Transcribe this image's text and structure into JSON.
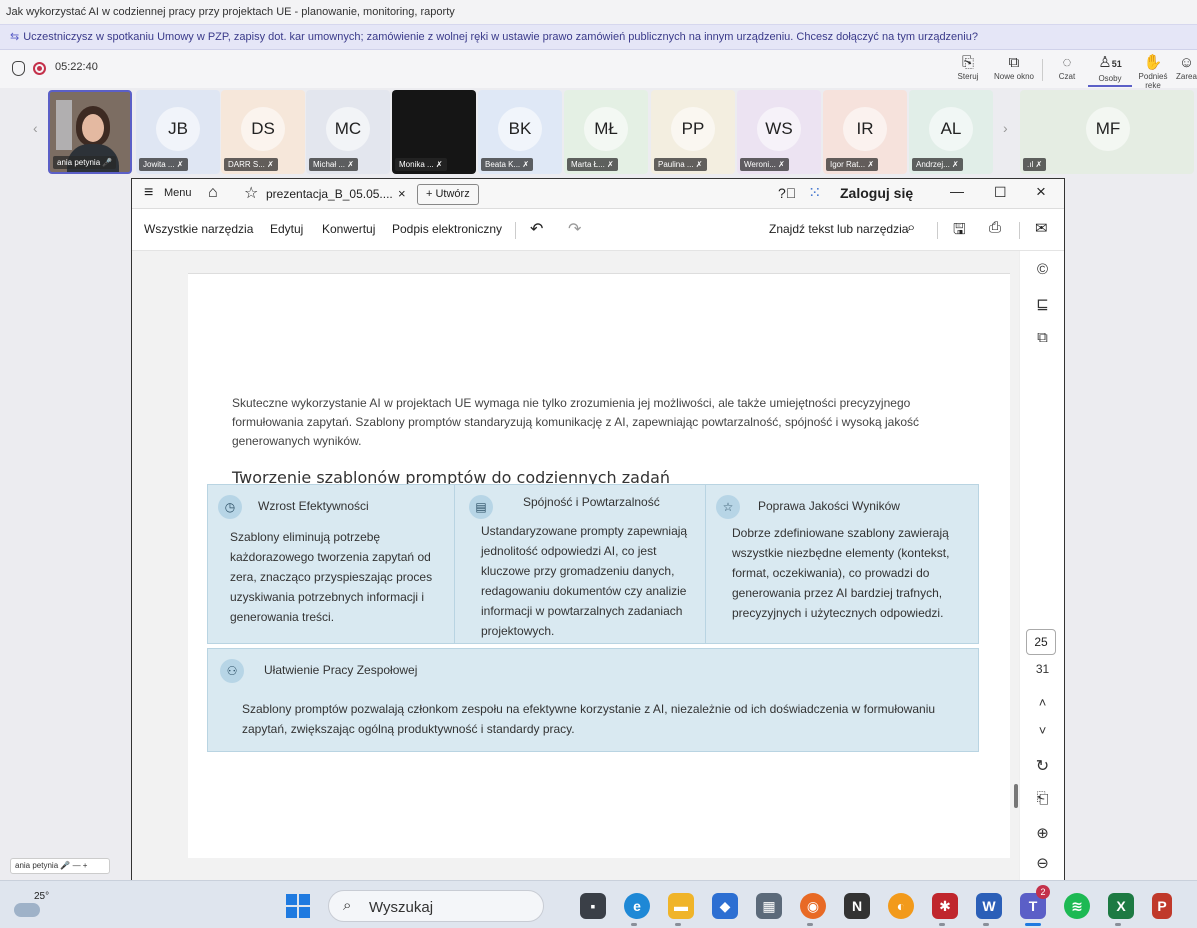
{
  "window_title": "Jak wykorzystać AI w codziennej pracy przy projektach UE - planowanie, monitoring, raporty",
  "notice": "Uczestniczysz w spotkaniu Umowy w PZP, zapisy dot. kar umownych; zamówienie z wolnej ręki w ustawie prawo zamówień publicznych na innym urządzeniu. Chcesz dołączyć na tym urządzeniu?",
  "meeting": {
    "timer": "05:22:40",
    "tools": [
      {
        "label": "Steruj",
        "icon": "control-icon"
      },
      {
        "label": "Nowe okno",
        "icon": "new-window-icon"
      },
      {
        "label": "Czat",
        "icon": "chat-icon"
      },
      {
        "label": "Osoby",
        "icon": "people-icon",
        "count": "51"
      },
      {
        "label": "Podnieś rękę",
        "icon": "raise-hand-icon"
      },
      {
        "label": "Zareaguj",
        "icon": "react-icon"
      }
    ]
  },
  "self_tile": {
    "name": "ania petynia"
  },
  "participants": [
    {
      "initials": "JB",
      "name": "Jowita ...",
      "color": "#dfe6f3"
    },
    {
      "initials": "DS",
      "name": "DARR S...",
      "color": "#f6e7da"
    },
    {
      "initials": "MC",
      "name": "Michał ...",
      "color": "#e3e6ee"
    },
    {
      "initials": "",
      "name": "Monika ...",
      "color": "#151515"
    },
    {
      "initials": "BK",
      "name": "Beata K...",
      "color": "#dfe8f6"
    },
    {
      "initials": "MŁ",
      "name": "Marta Ł...",
      "color": "#e4f0e4"
    },
    {
      "initials": "PP",
      "name": "Paulina ...",
      "color": "#f3eee0"
    },
    {
      "initials": "WS",
      "name": "Weroni...",
      "color": "#ece3f2"
    },
    {
      "initials": "IR",
      "name": "Igor Rat...",
      "color": "#f6e2dc"
    },
    {
      "initials": "AL",
      "name": "Andrzej...",
      "color": "#e1eee8"
    },
    {
      "initials": "MF",
      "name": ".ıl",
      "color": "#e5ede3"
    }
  ],
  "viewer": {
    "menu_label": "Menu",
    "tab_title": "prezentacja_B_05.05....",
    "new_tab_label": "Utwórz",
    "login_label": "Zaloguj się",
    "toolbar": [
      "Wszystkie narzędzia",
      "Edytuj",
      "Konwertuj",
      "Podpis elektroniczny"
    ],
    "search_label": "Znajdź tekst lub narzędzia",
    "page_current": "25",
    "page_total": "31"
  },
  "slide": {
    "title": "Tworzenie szablonów promptów do codziennych zadań",
    "intro": "Skuteczne wykorzystanie AI w projektach UE wymaga nie tylko zrozumienia jej możliwości, ale także umiejętności precyzyjnego formułowania zapytań. Szablony promptów standaryzują komunikację z AI, zapewniając powtarzalność, spójność i wysoką jakość generowanych wyników.",
    "cards": [
      {
        "title": "Wzrost Efektywności",
        "icon": "stopwatch-icon",
        "text": "Szablony eliminują potrzebę każdorazowego tworzenia zapytań od zera, znacząco przyspieszając proces uzyskiwania potrzebnych informacji i generowania treści."
      },
      {
        "title": "Spójność i Powtarzalność",
        "icon": "document-icon",
        "text": "Ustandaryzowane prompty zapewniają jednolitość odpowiedzi AI, co jest kluczowe przy gromadzeniu danych, redagowaniu dokumentów czy analizie informacji w powtarzalnych zadaniach projektowych."
      },
      {
        "title": "Poprawa Jakości Wyników",
        "icon": "star-icon",
        "text": "Dobrze zdefiniowane szablony zawierają wszystkie niezbędne elementy (kontekst, format, oczekiwania), co prowadzi do generowania przez AI bardziej trafnych, precyzyjnych i użytecznych odpowiedzi."
      },
      {
        "title": "Ułatwienie Pracy Zespołowej",
        "icon": "team-icon",
        "text": "Szablony promptów pozwalają członkom zespołu na efektywne korzystanie z AI, niezależnie od ich doświadczenia w formułowaniu zapytań, zwiększając ogólną produktywność i standardy pracy."
      }
    ]
  },
  "bottom_left_name": "ania petynia",
  "taskbar": {
    "temperature": "25°",
    "search_placeholder": "Wyszukaj",
    "teams_badge": "2"
  }
}
